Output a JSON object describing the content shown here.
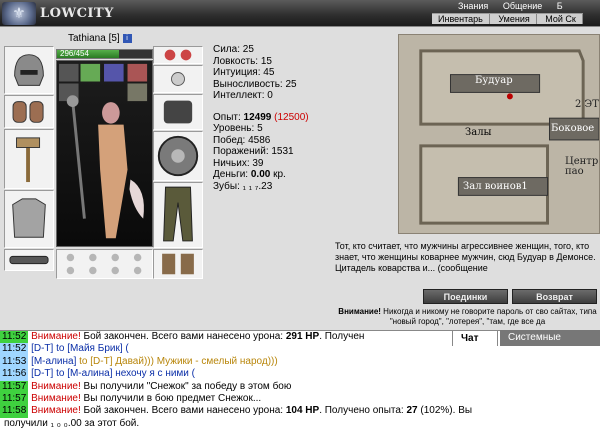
{
  "header": {
    "brand": "LOWCITY",
    "nav_top": [
      "Знания",
      "Общение",
      "Б"
    ],
    "nav_bottom": [
      "Инвентарь",
      "Умения",
      "Мой Ск"
    ]
  },
  "character": {
    "name": "Tathiana",
    "level_text": "[5]",
    "hp_text": "296/454",
    "hp_fraction": 0.652
  },
  "stats": {
    "strength": "Сила: 25",
    "agility": "Ловкость: 15",
    "intuition": "Интуиция: 45",
    "endurance": "Выносливость: 25",
    "intellect": "Интеллект: 0",
    "exp_label": "Опыт: ",
    "exp_value": "12499",
    "exp_next": "(12500)",
    "level": "Уровень: 5",
    "wins": "Побед: 4586",
    "losses": "Поражений: 1531",
    "draws": "Ничьих: 39",
    "money_label": "Деньги: ",
    "money_value": "0.00",
    "money_unit": " кр.",
    "teeth_label": "Зубы: ",
    "teeth_value": "₁ ₁ ₇.23"
  },
  "map": {
    "room1": "Будуар",
    "room2": "Боковое",
    "room3": "Залы",
    "room4": "Центр пао",
    "room5": "Зал воинов1",
    "floor": "2 ЭТ",
    "description": "Тот, кто считает, что мужчины агрессивнее женщин, того, кто знает, что женщины коварнее мужчин, сюд Будуар в Демонсе. Цитадель коварства и... (сообщение",
    "button_duels": "Поединки",
    "button_return": "Возврат",
    "warning_label": "Внимание!",
    "warning_text": " Никогда и никому не говорите пароль от сво сайтах, типа \"новый город\", \"лотерея\", \"там, где все да"
  },
  "chat_tabs": {
    "chat": "Чат",
    "system": "Системные сообще"
  },
  "chat": {
    "lines": [
      {
        "time": "11:52",
        "p1": "Внимание!",
        "p2": " Бой закончен. Всего вами нанесено урона: ",
        "p3": "291 HP",
        "p4": ". Получен"
      },
      {
        "time": "11:52",
        "p1": "[D-T] to [Майя Брик] (",
        "p2": "",
        "p3": "",
        "p4": ""
      },
      {
        "time": "11:53",
        "p1": "[M-алина]",
        "p2": " to [D-T] Давай))) Мужики - смелый народ)))",
        "p3": "",
        "p4": ""
      },
      {
        "time": "11:56",
        "p1": "[D-T] to [M-алина] ",
        "p2": "нехочу я с ними (",
        "p3": "",
        "p4": ""
      },
      {
        "time": "11:57",
        "p1": "Внимание!",
        "p2": " Вы получили \"Снежок\" за победу в этом бою",
        "p3": "",
        "p4": ""
      },
      {
        "time": "11:57",
        "p1": "Внимание!",
        "p2": " Вы получили в бою предмет Снежок...",
        "p3": "",
        "p4": ""
      },
      {
        "time": "11:58",
        "p1": "Внимание!",
        "p2": " Бой закончен. Всего вами нанесено урона: ",
        "p3": "104 HP",
        "p4": ". Получено опыта: "
      },
      {
        "time": "",
        "p1": "получили ",
        "p2": "₁ ₀ ₀.00",
        "p3": " за этот бой.",
        "p4": ""
      }
    ],
    "line7_extra": "27",
    "line7_tail": " (102%). Вы"
  }
}
